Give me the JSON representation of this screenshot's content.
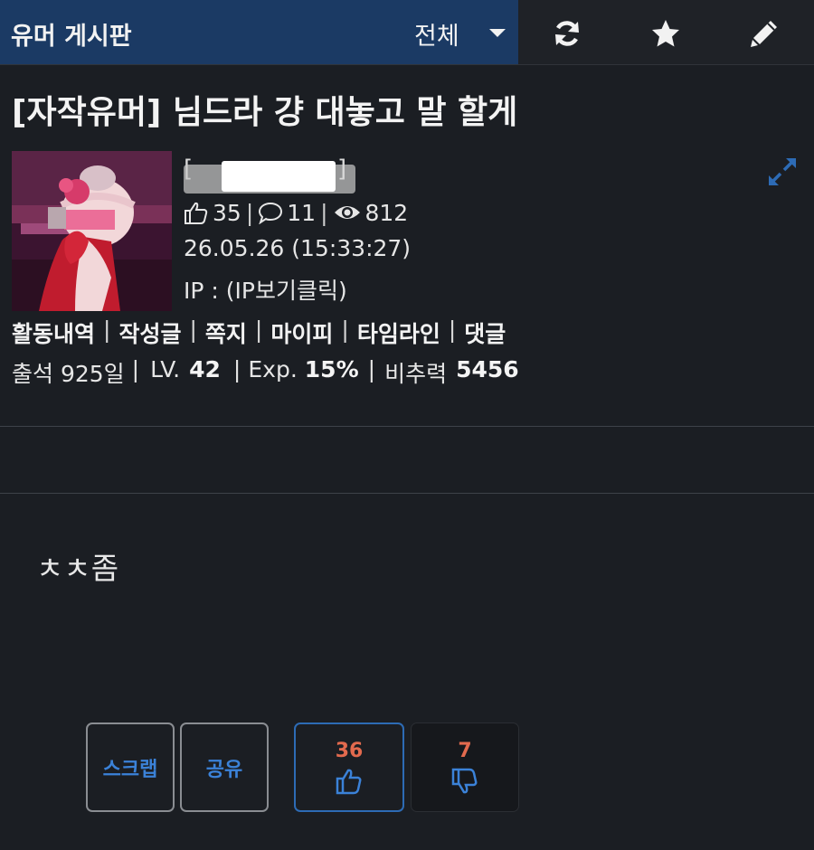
{
  "header": {
    "board_name": "유머 게시판",
    "filter_label": "전체",
    "icons": [
      "refresh-icon",
      "star-icon",
      "pencil-icon"
    ]
  },
  "post": {
    "title": "[자작유머] 님드라 걍 대놓고 말 할게",
    "body": "ㅊㅊ좀"
  },
  "author": {
    "likes": "35",
    "comments": "11",
    "views": "812",
    "datetime": "26.05.26 (15:33:27)",
    "ip_label": "IP : (IP보기클릭)",
    "links": [
      "활동내역",
      "작성글",
      "쪽지",
      "마이피",
      "타임라인",
      "댓글"
    ],
    "attendance_label": "출석 925일",
    "level_label": "LV.",
    "level_value": "42",
    "exp_label": "Exp.",
    "exp_value": "15%",
    "ratio_label": "비추력",
    "ratio_value": "5456"
  },
  "actions": {
    "scrap_label": "스크랩",
    "share_label": "공유",
    "like_count": "36",
    "dislike_count": "7"
  },
  "colors": {
    "header_tab_bg": "#1b3a64",
    "page_bg": "#1b1e23",
    "accent_blue": "#3b82d8",
    "vote_count": "#e26a4e"
  }
}
